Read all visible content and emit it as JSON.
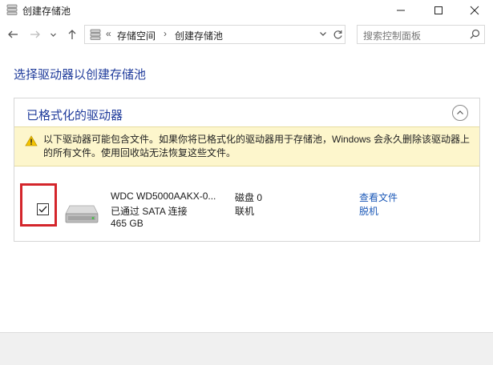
{
  "window": {
    "title": "创建存储池"
  },
  "address": {
    "prefix": "«",
    "crumbs": [
      "存储空间",
      "创建存储池"
    ],
    "separator": "›"
  },
  "search": {
    "placeholder": "搜索控制面板"
  },
  "page": {
    "heading": "选择驱动器以创建存储池"
  },
  "panel": {
    "title": "已格式化的驱动器",
    "warning": "以下驱动器可能包含文件。如果你将已格式化的驱动器用于存储池，Windows 会永久删除该驱动器上的所有文件。使用回收站无法恢复这些文件。",
    "drive": {
      "name": "WDC WD5000AAKX-0...",
      "status": "已通过 SATA 连接",
      "size": "465 GB",
      "disk": "磁盘 0",
      "state": "联机",
      "link_view": "查看文件",
      "link_offline": "脱机",
      "checked": true
    }
  },
  "colors": {
    "accent": "#1f3b9b",
    "link": "#1c59b8",
    "warning_bg": "#fdf6cc",
    "highlight": "#d4252b"
  },
  "icons": [
    "storage-app-icon",
    "minimize-icon",
    "maximize-icon",
    "close-icon",
    "back-arrow-icon",
    "forward-arrow-icon",
    "chevron-down-icon",
    "up-arrow-icon",
    "storage-icon",
    "refresh-icon",
    "search-icon",
    "collapse-icon",
    "warning-icon",
    "checkbox-icon",
    "hard-drive-icon"
  ]
}
